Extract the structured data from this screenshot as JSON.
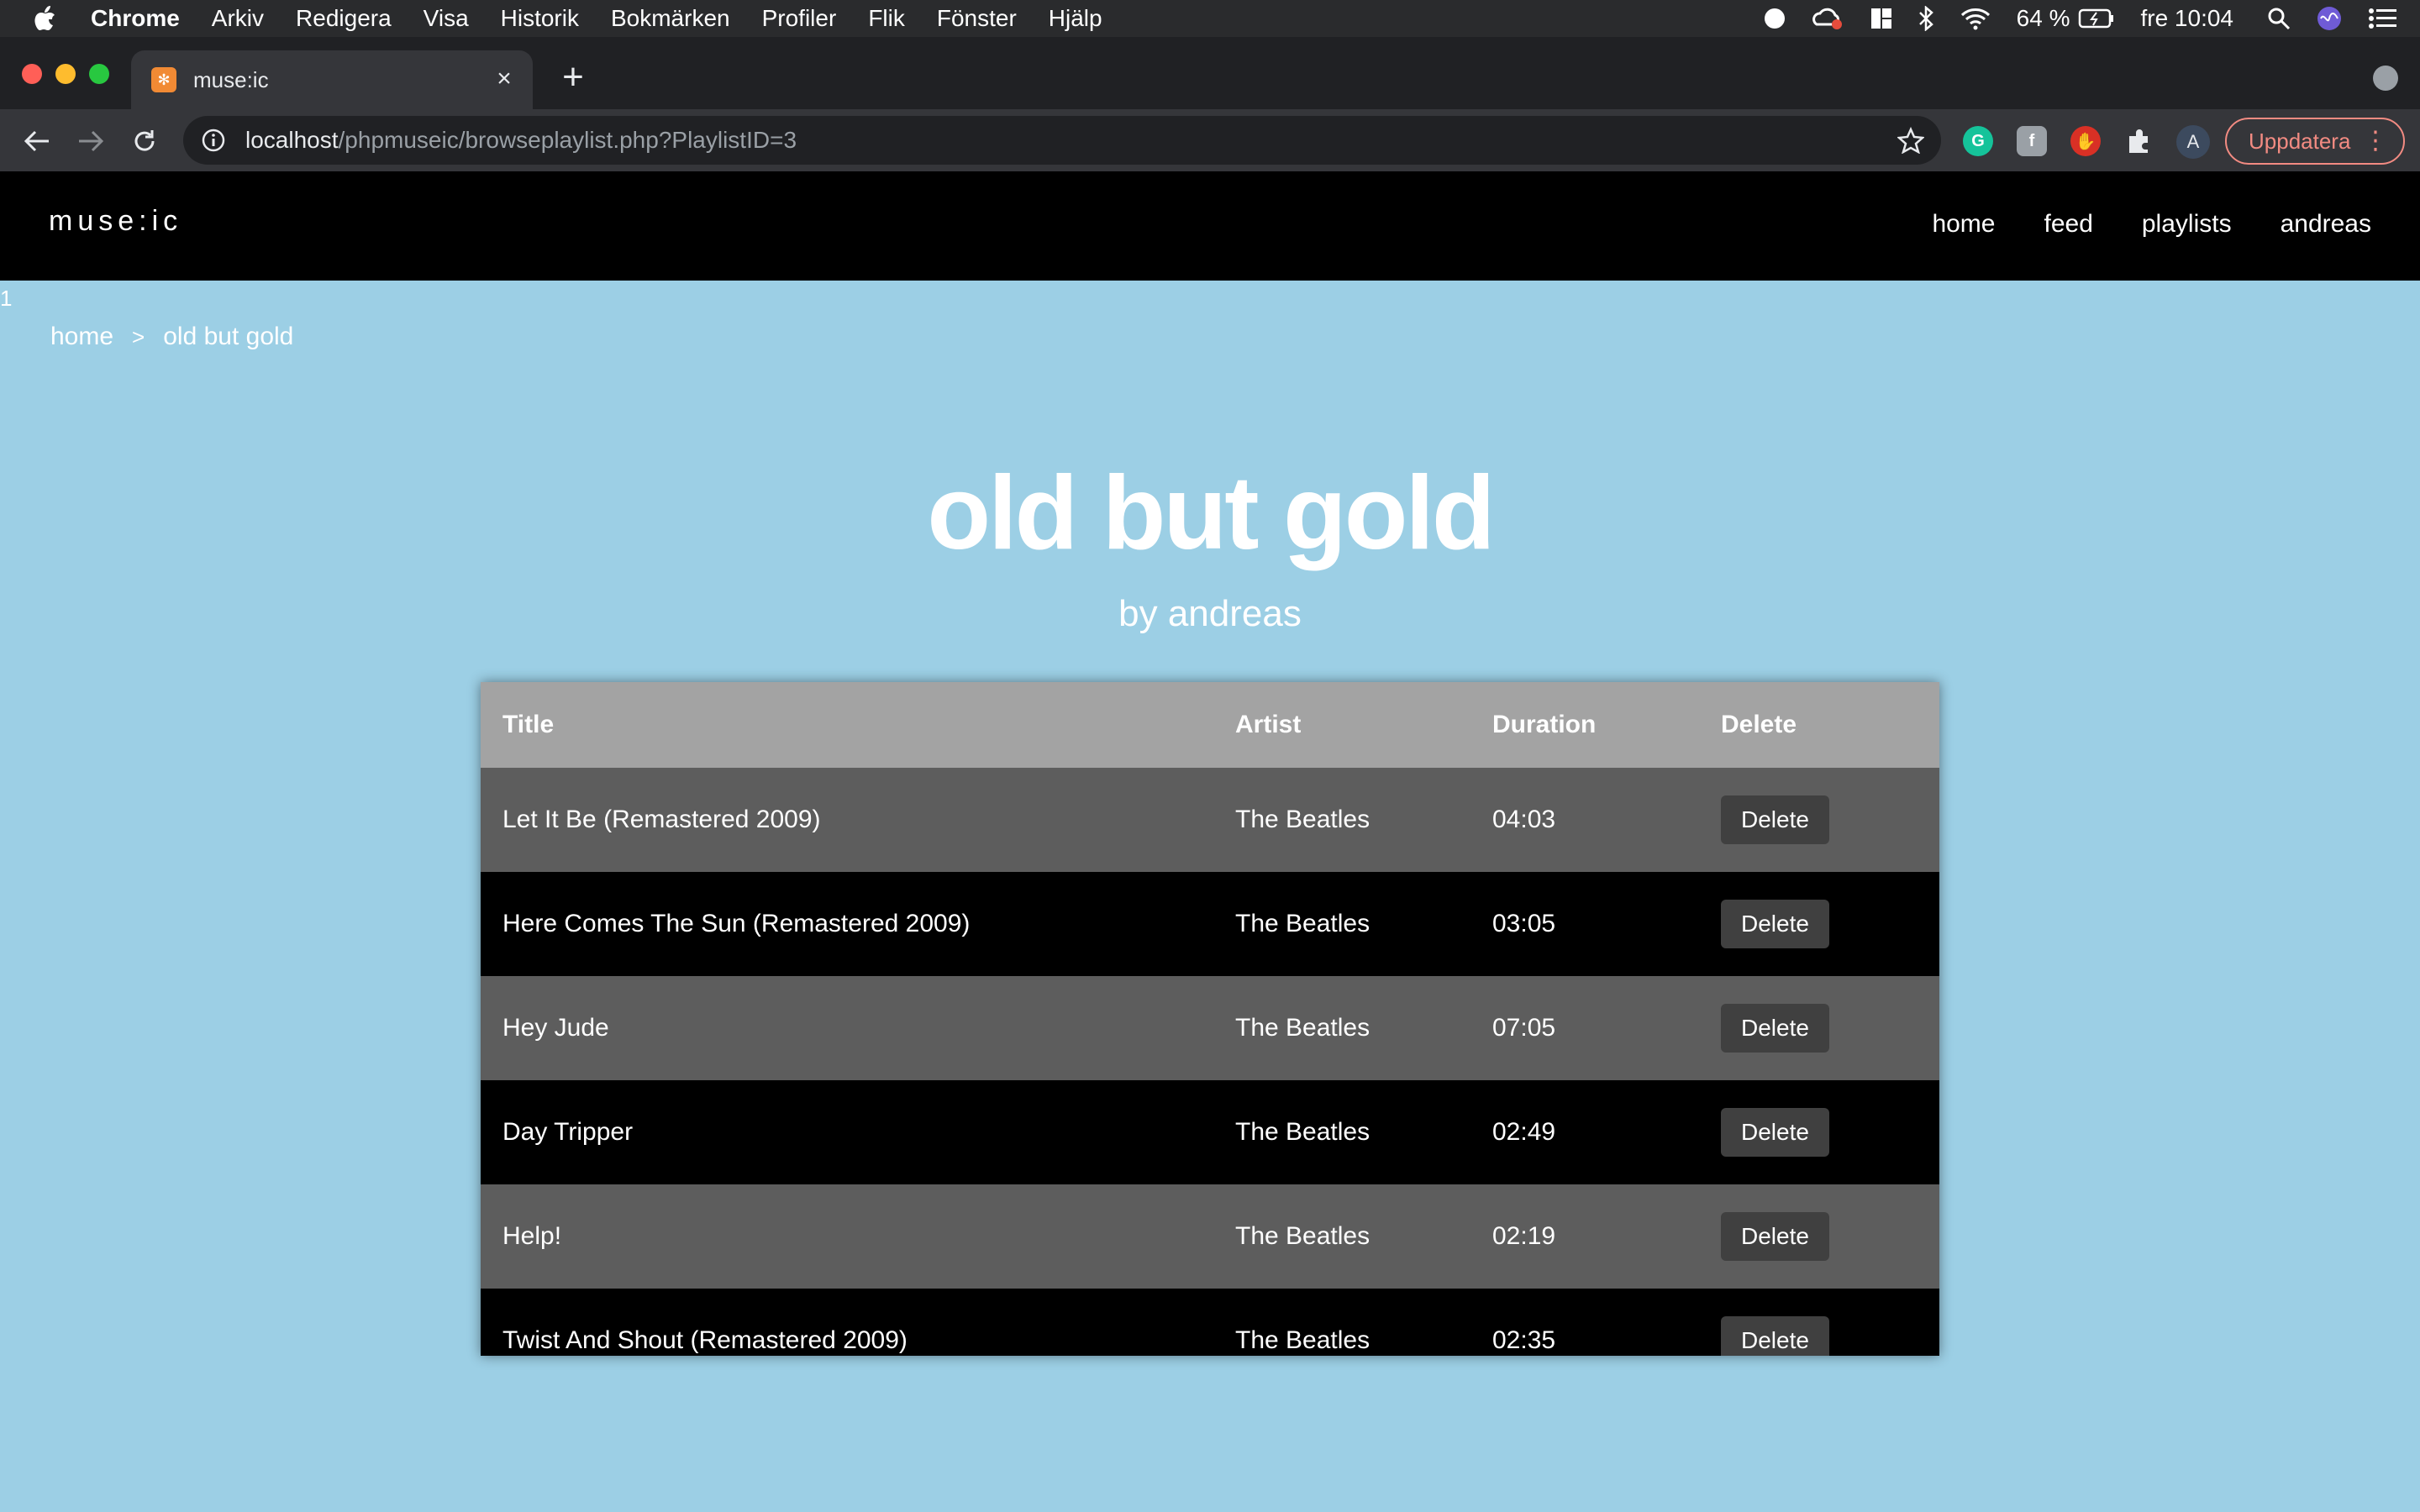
{
  "menubar": {
    "app": "Chrome",
    "items": [
      "Arkiv",
      "Redigera",
      "Visa",
      "Historik",
      "Bokmärken",
      "Profiler",
      "Flik",
      "Fönster",
      "Hjälp"
    ],
    "battery": "64 %",
    "clock": "fre 10:04"
  },
  "browser": {
    "tab_title": "muse:ic",
    "url_host": "localhost",
    "url_path": "/phpmuseic/browseplaylist.php?PlaylistID=3",
    "profile_initial": "A",
    "update_label": "Uppdatera"
  },
  "site": {
    "logo": "muse:ic",
    "nav": [
      "home",
      "feed",
      "playlists",
      "andreas"
    ]
  },
  "stray_text": "1",
  "breadcrumb": {
    "home": "home",
    "separator": ">",
    "current": "old but gold"
  },
  "playlist": {
    "title": "old but gold",
    "author": "by andreas"
  },
  "table": {
    "headers": [
      "Title",
      "Artist",
      "Duration",
      "Delete"
    ],
    "delete_label": "Delete",
    "rows": [
      {
        "title": "Let It Be (Remastered 2009)",
        "artist": "The Beatles",
        "duration": "04:03"
      },
      {
        "title": "Here Comes The Sun (Remastered 2009)",
        "artist": "The Beatles",
        "duration": "03:05"
      },
      {
        "title": "Hey Jude",
        "artist": "The Beatles",
        "duration": "07:05"
      },
      {
        "title": "Day Tripper",
        "artist": "The Beatles",
        "duration": "02:49"
      },
      {
        "title": "Help!",
        "artist": "The Beatles",
        "duration": "02:19"
      },
      {
        "title": "Twist And Shout (Remastered 2009)",
        "artist": "The Beatles",
        "duration": "02:35"
      }
    ]
  }
}
